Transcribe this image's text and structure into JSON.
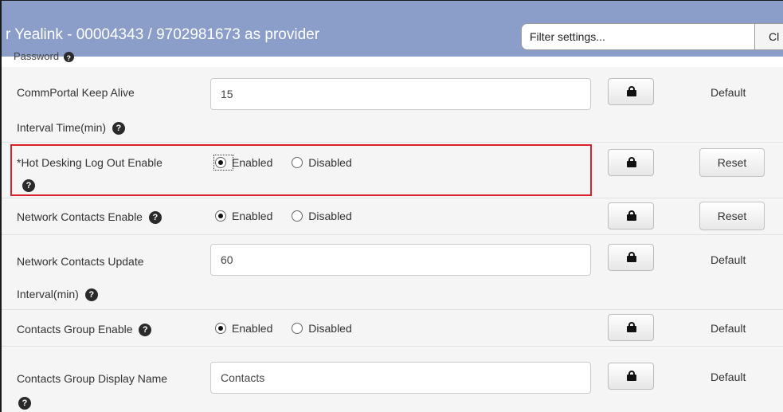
{
  "header": {
    "title": "r Yealink - 00004343 / 9702981673 as provider",
    "filter_value": "Filter settings...",
    "clear_label": "Cl"
  },
  "partial_row": {
    "label": "Password"
  },
  "rows": [
    {
      "label": "CommPortal Keep Alive",
      "label_line2": "Interval Time(min)",
      "value": "15",
      "status": "Default"
    },
    {
      "label": "*Hot Desking Log Out Enable",
      "enabled_label": "Enabled",
      "disabled_label": "Disabled",
      "selected": "Enabled",
      "status": "Reset"
    },
    {
      "label": "Network Contacts Enable",
      "enabled_label": "Enabled",
      "disabled_label": "Disabled",
      "selected": "Enabled",
      "status": "Reset"
    },
    {
      "label": "Network Contacts Update",
      "label_line2": "Interval(min)",
      "value": "60",
      "status": "Default"
    },
    {
      "label": "Contacts Group Enable",
      "enabled_label": "Enabled",
      "disabled_label": "Disabled",
      "selected": "Enabled",
      "status": "Default"
    },
    {
      "label": "Contacts Group Display Name",
      "value": "Contacts",
      "status": "Default"
    }
  ],
  "icons": {
    "help": "question-icon",
    "lock": "lock-icon"
  },
  "colors": {
    "header_bg": "#8b9ec9",
    "highlight_border": "#d9212b",
    "row_bg": "#f5f5f5"
  }
}
